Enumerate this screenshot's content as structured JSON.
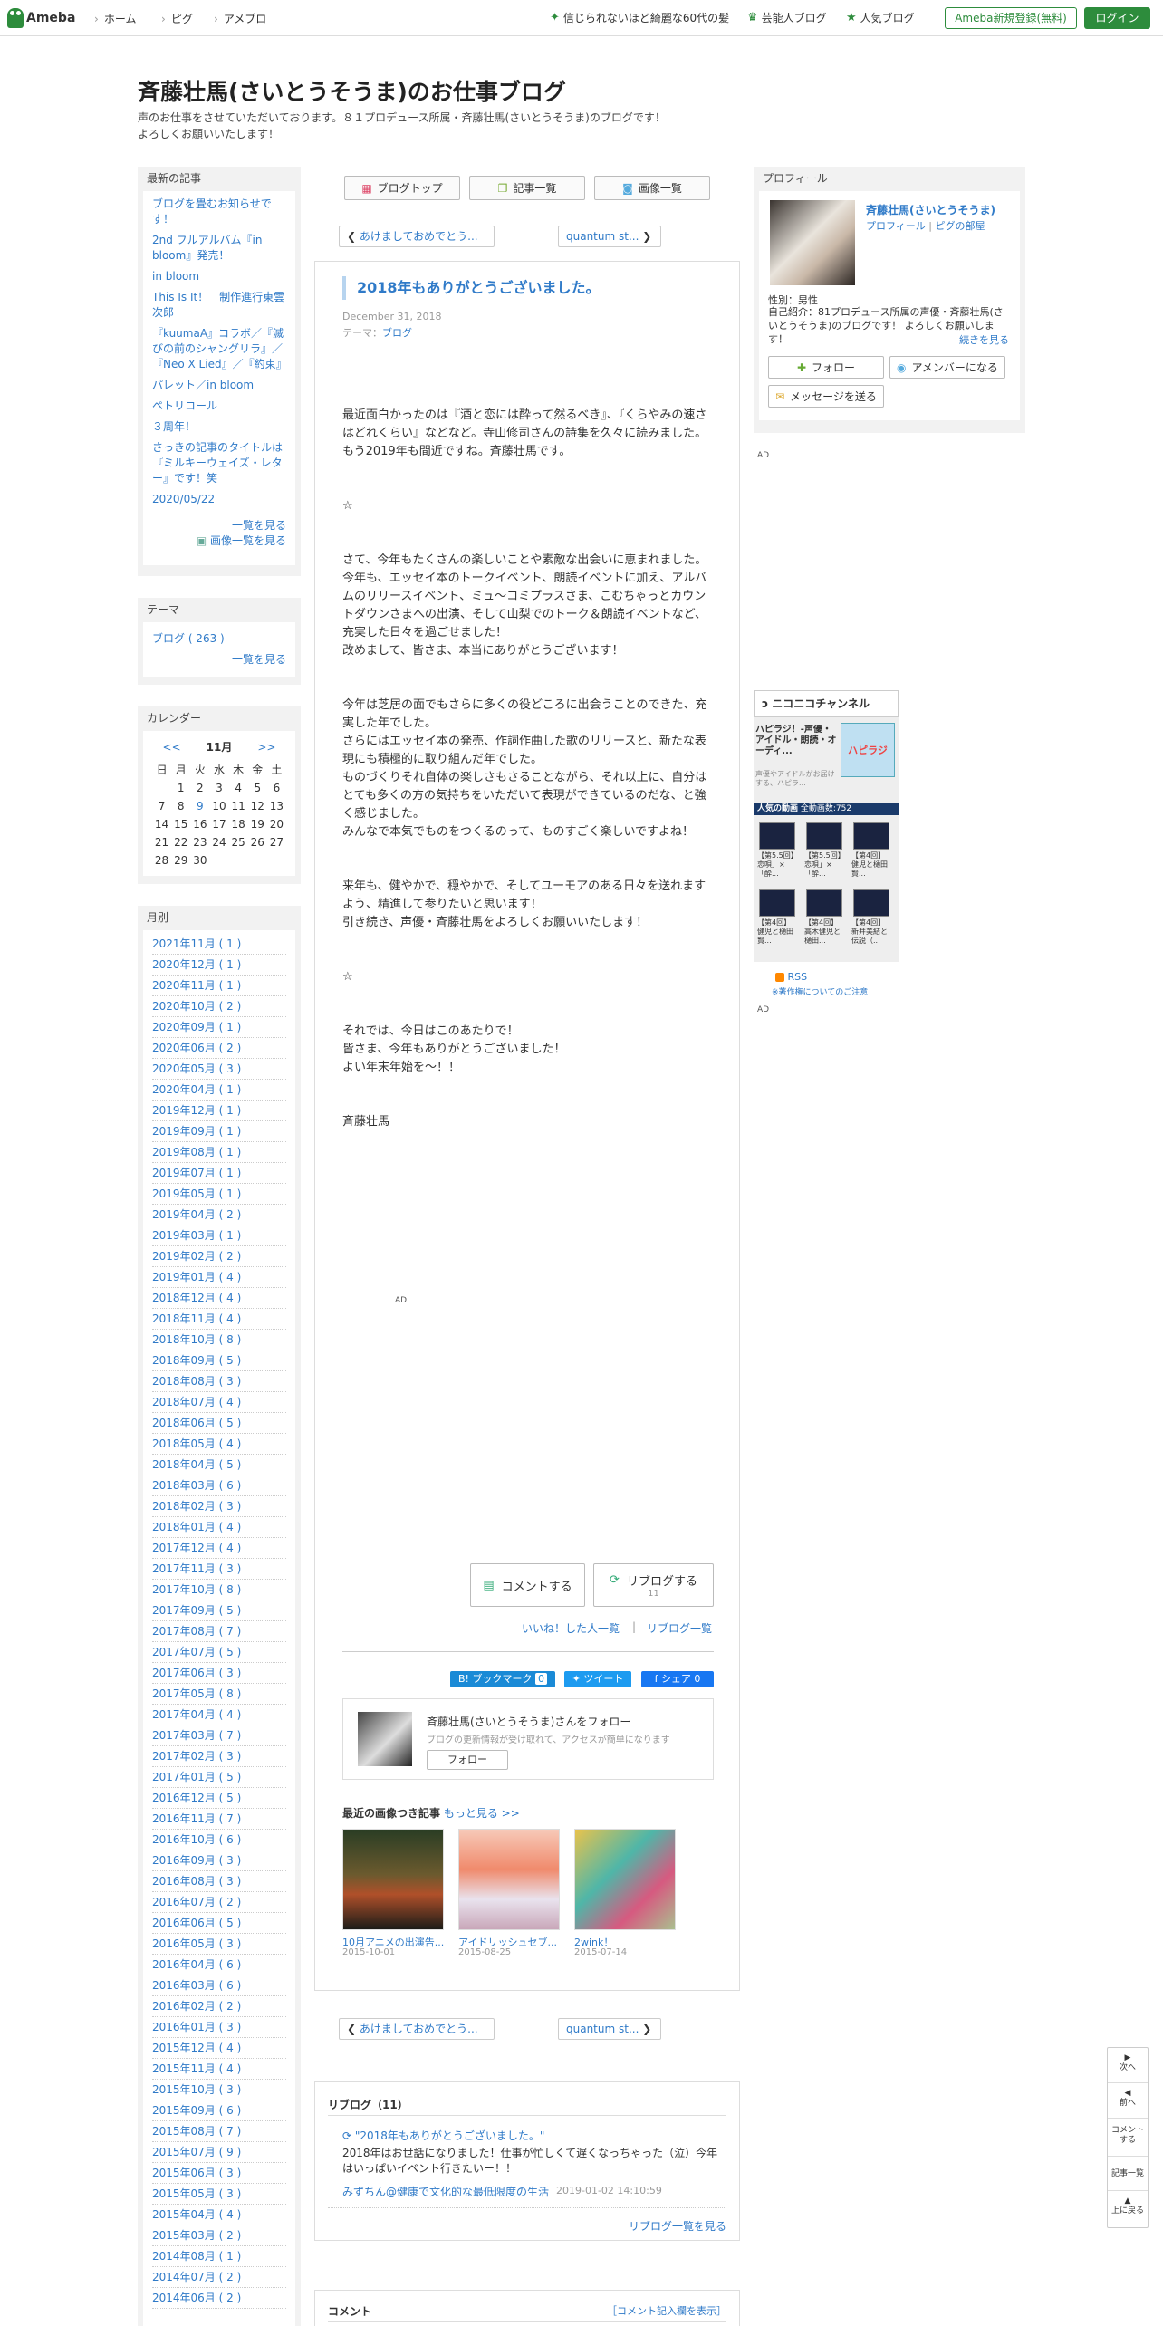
{
  "header": {
    "logo": "Ameba",
    "nav": [
      "ホーム",
      "ピグ",
      "アメブロ"
    ],
    "topics": [
      "信じられないほど綺麗な60代の髪",
      "芸能人ブログ",
      "人気ブログ"
    ],
    "register_label": "Ameba新規登録(無料)",
    "login_label": "ログイン"
  },
  "blog": {
    "title": "斉藤壮馬(さいとうそうま)のお仕事ブログ",
    "description_1": "声のお仕事をさせていただいております。８１プロデュース所属・斉藤壮馬(さいとうそうま)のブログです！",
    "description_2": "よろしくお願いいたします！"
  },
  "left": {
    "recent_header": "最新の記事",
    "recent": [
      "ブログを畳むお知らせです！",
      "2nd フルアルバム『in bloom』発売！",
      "in bloom",
      "This Is It！　制作進行東雲次郎",
      "『kuumaA』コラボ／『滅びの前のシャングリラ』／『Neo X Lied』／『約束』",
      "パレット／in bloom",
      "ペトリコール",
      "３周年！",
      "さっきの記事のタイトルは『ミルキーウェイズ・レター』です！笑",
      "2020/05/22"
    ],
    "recent_more": "一覧を見る",
    "recent_images": "画像一覧を見る",
    "theme_header": "テーマ",
    "theme_item": "ブログ ( 263 )",
    "theme_more": "一覧を見る",
    "calendar_header": "カレンダー",
    "calendar_prev": "<<",
    "calendar_month": "11月",
    "calendar_next": ">>",
    "calendar_days": [
      "日",
      "月",
      "火",
      "水",
      "木",
      "金",
      "土"
    ],
    "calendar_rows": [
      [
        "",
        "1",
        "2",
        "3",
        "4",
        "5",
        "6"
      ],
      [
        "7",
        "8",
        "9",
        "10",
        "11",
        "12",
        "13"
      ],
      [
        "14",
        "15",
        "16",
        "17",
        "18",
        "19",
        "20"
      ],
      [
        "21",
        "22",
        "23",
        "24",
        "25",
        "26",
        "27"
      ],
      [
        "28",
        "29",
        "30",
        "",
        "",
        "",
        ""
      ]
    ],
    "calendar_link_day": "9",
    "month_header": "月別",
    "months": [
      "2021年11月 ( 1 )",
      "2020年12月 ( 1 )",
      "2020年11月 ( 1 )",
      "2020年10月 ( 2 )",
      "2020年09月 ( 1 )",
      "2020年06月 ( 2 )",
      "2020年05月 ( 3 )",
      "2020年04月 ( 1 )",
      "2019年12月 ( 1 )",
      "2019年09月 ( 1 )",
      "2019年08月 ( 1 )",
      "2019年07月 ( 1 )",
      "2019年05月 ( 1 )",
      "2019年04月 ( 2 )",
      "2019年03月 ( 1 )",
      "2019年02月 ( 2 )",
      "2019年01月 ( 4 )",
      "2018年12月 ( 4 )",
      "2018年11月 ( 4 )",
      "2018年10月 ( 8 )",
      "2018年09月 ( 5 )",
      "2018年08月 ( 3 )",
      "2018年07月 ( 4 )",
      "2018年06月 ( 5 )",
      "2018年05月 ( 4 )",
      "2018年04月 ( 5 )",
      "2018年03月 ( 6 )",
      "2018年02月 ( 3 )",
      "2018年01月 ( 4 )",
      "2017年12月 ( 4 )",
      "2017年11月 ( 3 )",
      "2017年10月 ( 8 )",
      "2017年09月 ( 5 )",
      "2017年08月 ( 7 )",
      "2017年07月 ( 5 )",
      "2017年06月 ( 3 )",
      "2017年05月 ( 8 )",
      "2017年04月 ( 4 )",
      "2017年03月 ( 7 )",
      "2017年02月 ( 3 )",
      "2017年01月 ( 5 )",
      "2016年12月 ( 5 )",
      "2016年11月 ( 7 )",
      "2016年10月 ( 6 )",
      "2016年09月 ( 3 )",
      "2016年08月 ( 3 )",
      "2016年07月 ( 2 )",
      "2016年06月 ( 5 )",
      "2016年05月 ( 3 )",
      "2016年04月 ( 6 )",
      "2016年03月 ( 6 )",
      "2016年02月 ( 2 )",
      "2016年01月 ( 3 )",
      "2015年12月 ( 4 )",
      "2015年11月 ( 4 )",
      "2015年10月 ( 3 )",
      "2015年09月 ( 6 )",
      "2015年08月 ( 7 )",
      "2015年07月 ( 9 )",
      "2015年06月 ( 3 )",
      "2015年05月 ( 3 )",
      "2015年04月 ( 4 )",
      "2015年03月 ( 2 )",
      "2014年08月 ( 1 )",
      "2014年07月 ( 2 )",
      "2014年06月 ( 2 )"
    ]
  },
  "center": {
    "tab_top": "ブログトップ",
    "tab_list": "記事一覧",
    "tab_images": "画像一覧",
    "prev_label": "あけましておめでとう...",
    "next_label": "quantum st...",
    "title": "2018年もありがとうございました。",
    "date": "December 31, 2018",
    "theme_prefix": "テーマ：",
    "theme": "ブログ",
    "body": [
      "最近面白かったのは『酒と恋には酔って然るべき』、『くらやみの速さはどれくらい』などなど。寺山修司さんの詩集を久々に読みました。",
      "もう2019年も間近ですね。斉藤壮馬です。",
      "",
      "",
      "☆",
      "",
      "",
      "さて、今年もたくさんの楽しいことや素敵な出会いに恵まれました。",
      "今年も、エッセイ本のトークイベント、朗読イベントに加え、アルバムのリリースイベント、ミュ〜コミプラスさま、こむちゃっとカウントダウンさまへの出演、そして山梨でのトーク＆朗読イベントなど、充実した日々を過ごせました！",
      "改めまして、皆さま、本当にありがとうございます！",
      "",
      "",
      "今年は芝居の面でもさらに多くの役どころに出会うことのできた、充実した年でした。",
      "さらにはエッセイ本の発売、作詞作曲した歌のリリースと、新たな表現にも積極的に取り組んだ年でした。",
      "ものづくりそれ自体の楽しさもさることながら、それ以上に、自分はとても多くの方の気持ちをいただいて表現ができているのだな、と強く感じました。",
      "みんなで本気でものをつくるのって、ものすごく楽しいですよね！",
      "",
      "",
      "来年も、健やかで、穏やかで、そしてユーモアのある日々を送れますよう、精進して参りたいと思います！",
      "引き続き、声優・斉藤壮馬をよろしくお願いいたします！",
      "",
      "",
      "☆",
      "",
      "",
      "それでは、今日はこのあたりで！",
      "皆さま、今年もありがとうございました！",
      "よい年末年始を〜！！",
      "",
      "",
      "斉藤壮馬"
    ],
    "ad": "AD",
    "comment_btn": "コメントする",
    "reblog_btn": "リブログする",
    "reblog_count": "11",
    "liked_link": "いいね！した人一覧",
    "reblog_list_link": "リブログ一覧",
    "hatena_label": "B! ブックマーク",
    "hatena_count": "0",
    "tweet_label": "ツイート",
    "share_label": "シェア 0",
    "follow_name": "斉藤壮馬(さいとうそうま)さんをフォロー",
    "follow_sub": "ブログの更新情報が受け取れて、アクセスが簡単になります",
    "follow_btn": "フォロー",
    "recent_images_header": "最近の画像つき記事",
    "recent_images_more": "もっと見る >>",
    "images": [
      {
        "caption": "10月アニメの出演告...",
        "date": "2015-10-01"
      },
      {
        "caption": "アイドリッシュセブ...",
        "date": "2015-08-25"
      },
      {
        "caption": "2wink！",
        "date": "2015-07-14"
      }
    ],
    "reblog_header": "リブログ（11）",
    "reblog_entry_title": "\"2018年もありがとうございました。\"",
    "reblog_entry_text": "2018年はお世話になりました！仕事が忙しくて遅くなっちゃった（泣）今年はいっぱいイベント行きたいー！！",
    "reblog_entry_author": "みずちん@健康で文化的な最低限度の生活",
    "reblog_entry_date": "2019-01-02 14:10:59",
    "reblog_more": "リブログ一覧を見る",
    "comment_header": "コメント",
    "comment_show": "［コメント記入欄を表示］"
  },
  "right": {
    "profile_header": "プロフィール",
    "name": "斉藤壮馬(さいとうそうま)",
    "profile_link": "プロフィール",
    "pig_link": "ピグの部屋",
    "gender": "性別：男性",
    "intro": "自己紹介：81プロデュース所属の声優・斉藤壮馬(さいとうそうま)のブログです！ よろしくお願いします！",
    "intro_more": "続きを見る",
    "follow_btn": "フォロー",
    "member_btn": "アメンバーになる",
    "message_btn": "メッセージを送る",
    "ad": "AD",
    "nico_logo": "ニコニコチャンネル",
    "nico_title": "ハピラジ！-声優・アイドル・朗読・オーディ...",
    "nico_desc": "声優やアイドルがお届けする、ハピラ...",
    "nico_popular": "人気の動画",
    "nico_count": "全動画数:752",
    "nico_badge": "ハピラジ",
    "nico_videos": [
      "【第5.5回】恋唄」×「酔...",
      "【第5.5回】恋唄」×「酔...",
      "【第4回】健児と樋田賢...",
      "【第4回】健児と樋田賢...",
      "【第4回】高木健児と樋田...",
      "【第4回】新井美結と伝説（..."
    ],
    "rss": "RSS",
    "copyright": "※著作権についてのご注意",
    "ad2": "AD"
  },
  "sidenav": {
    "next": "次へ",
    "prev": "前へ",
    "comment": "コメントする",
    "list": "記事一覧",
    "top": "上に戻る"
  }
}
